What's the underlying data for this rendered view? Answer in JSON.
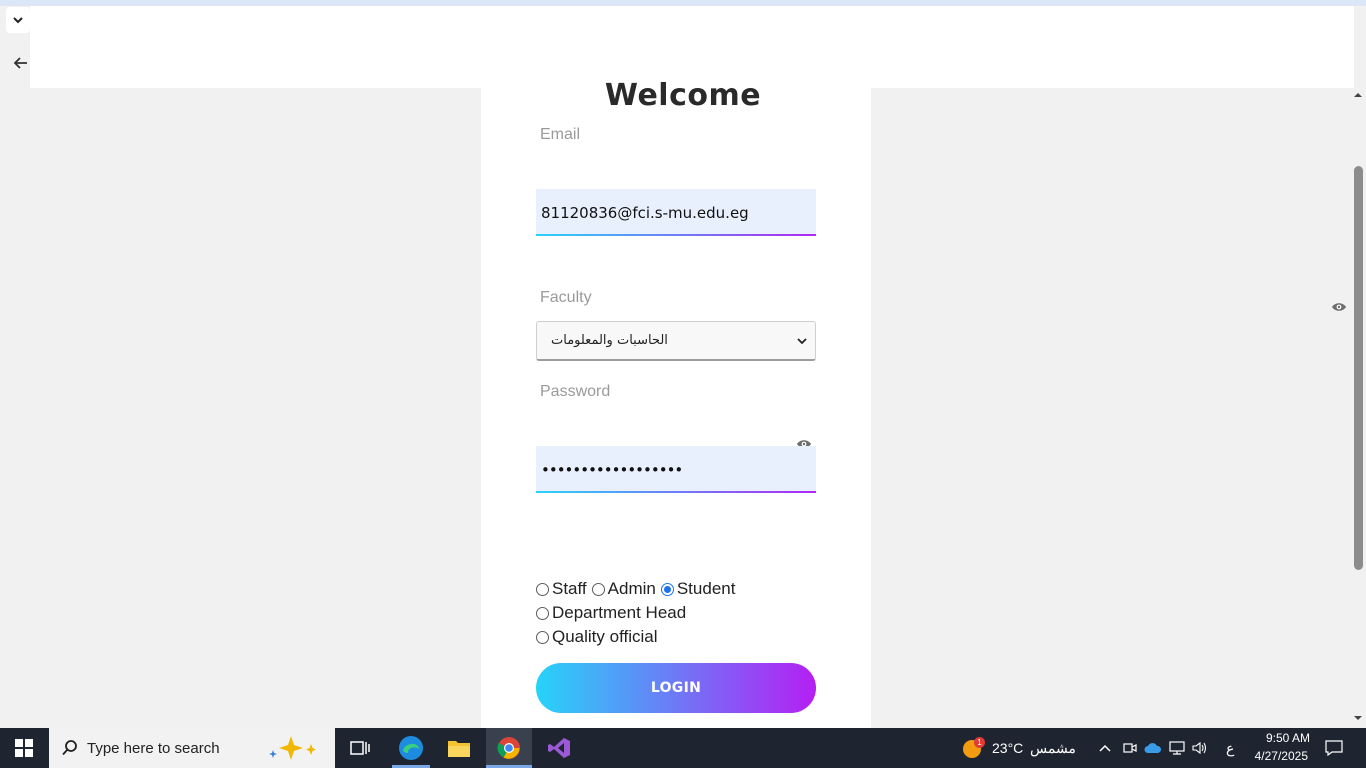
{
  "page": {
    "title": "Welcome",
    "email_label": "Email",
    "email_value": "81120836@fci.s-mu.edu.eg",
    "faculty_label": "Faculty",
    "faculty_selected": "الحاسبات والمعلومات",
    "password_label": "Password",
    "password_value": "••••••••••••••••••",
    "roles": [
      {
        "label": "Staff",
        "checked": false
      },
      {
        "label": "Admin",
        "checked": false
      },
      {
        "label": "Student",
        "checked": true
      },
      {
        "label": "Department Head",
        "checked": false
      },
      {
        "label": "Quality official",
        "checked": false
      }
    ],
    "login_label": "LOGIN"
  },
  "taskbar": {
    "search_placeholder": "Type here to search",
    "weather_temp": "23°C",
    "weather_text": "مشمس",
    "weather_badge": "1",
    "lang": "ع",
    "time": "9:50 AM",
    "date": "4/27/2025"
  },
  "colors": {
    "accent_start": "#27d3f9",
    "accent_end": "#b51ff4",
    "input_bg": "#e8f0fe",
    "taskbar_bg": "#1f2530"
  }
}
